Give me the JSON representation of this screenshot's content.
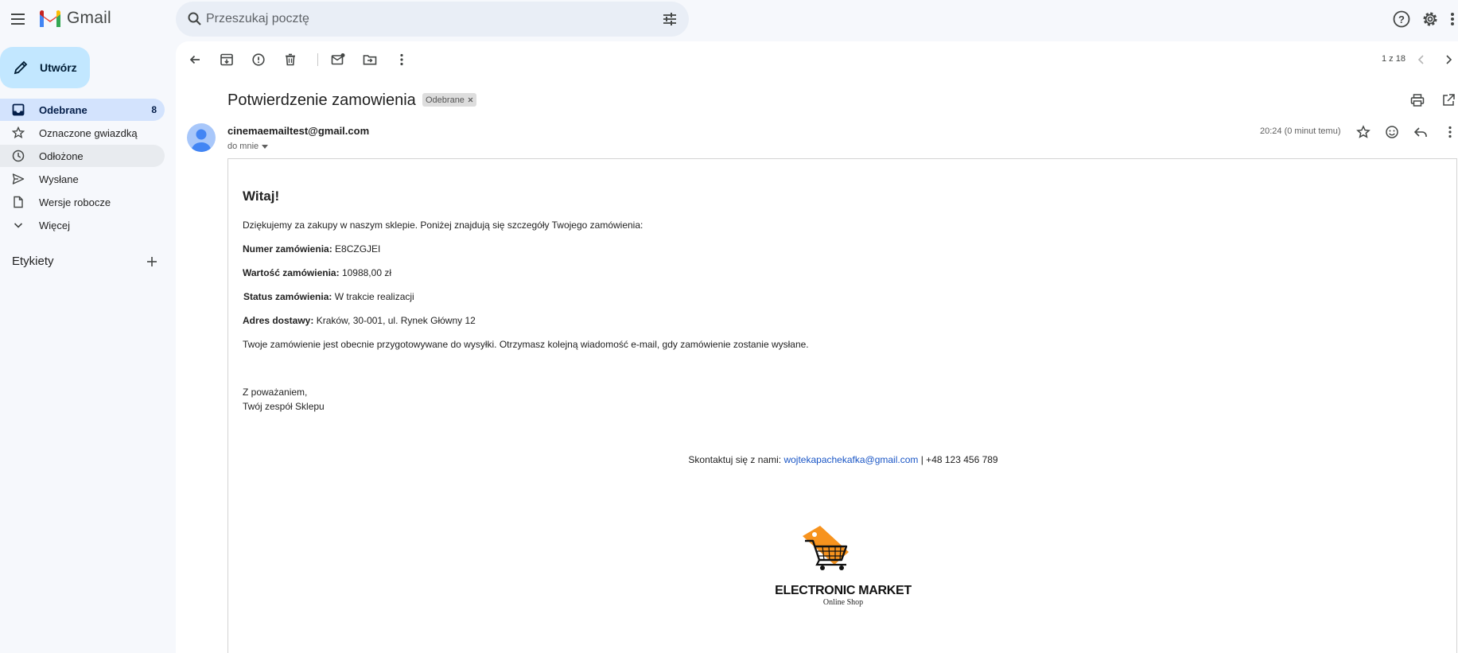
{
  "app": {
    "name": "Gmail"
  },
  "search": {
    "placeholder": "Przeszukaj pocztę"
  },
  "compose": {
    "label": "Utwórz"
  },
  "sidebar": {
    "items": [
      {
        "label": "Odebrane",
        "count": "8"
      },
      {
        "label": "Oznaczone gwiazdką",
        "count": ""
      },
      {
        "label": "Odłożone",
        "count": ""
      },
      {
        "label": "Wysłane",
        "count": ""
      },
      {
        "label": "Wersje robocze",
        "count": ""
      },
      {
        "label": "Więcej",
        "count": ""
      }
    ],
    "labels_heading": "Etykiety"
  },
  "toolbar": {
    "pager": "1 z 18"
  },
  "message": {
    "subject": "Potwierdzenie zamowienia",
    "label_chip": "Odebrane",
    "sender": "cinemaemailtest@gmail.com",
    "recipient": "do mnie",
    "time": "20:24 (0 minut temu)"
  },
  "email_body": {
    "greeting": "Witaj!",
    "intro": "Dziękujemy za zakupy w naszym sklepie. Poniżej znajdują się szczegóły Twojego zamówienia:",
    "order_number_label": "Numer zamówienia:",
    "order_number": "E8CZGJEI",
    "order_value_label": "Wartość zamówienia:",
    "order_value": "10988,00 zł",
    "status_label": "Status zamówienia:",
    "status": "W trakcie realizacji",
    "address_label": "Adres dostawy:",
    "address": "Kraków, 30-001, ul. Rynek Główny 12",
    "shipping_note": "Twoje zamówienie jest obecnie przygotowywane do wysyłki. Otrzymasz kolejną wiadomość e-mail, gdy zamówienie zostanie wysłane.",
    "closing": "Z poważaniem,",
    "signature": "Twój zespół Sklepu",
    "contact_prefix": "Skontaktuj się z nami:",
    "contact_email": "wojtekapachekafka@gmail.com",
    "contact_phone": "| +48 123 456 789",
    "shop_name": "ELECTRONIC MARKET",
    "shop_tagline": "Online Shop"
  },
  "colors": {
    "accent": "#0b57d0",
    "compose_bg": "#c2e7ff",
    "active_nav": "#d3e3fd",
    "logo_orange": "#f7931e",
    "link": "#1a56c6"
  }
}
